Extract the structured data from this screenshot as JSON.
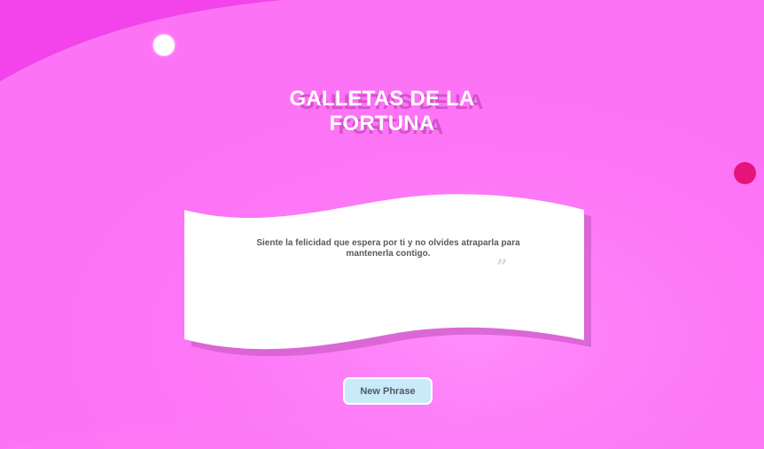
{
  "app": {
    "title_lines": [
      "GALLETAS DE LA",
      "FORTUNA"
    ]
  },
  "fortune": {
    "phrase": "Siente la felicidad que espera por ti y no olvides atraparla para mantenerla contigo.",
    "quote_mark": "”"
  },
  "actions": {
    "new_phrase_label": "New Phrase"
  },
  "colors": {
    "background": "#fb6cf6",
    "accent_dot": "#e6137a",
    "paper": "#ffffff",
    "paper_shadow": "#d562d0",
    "button_bg": "#c9eaf9",
    "button_text": "#4e5b63"
  }
}
